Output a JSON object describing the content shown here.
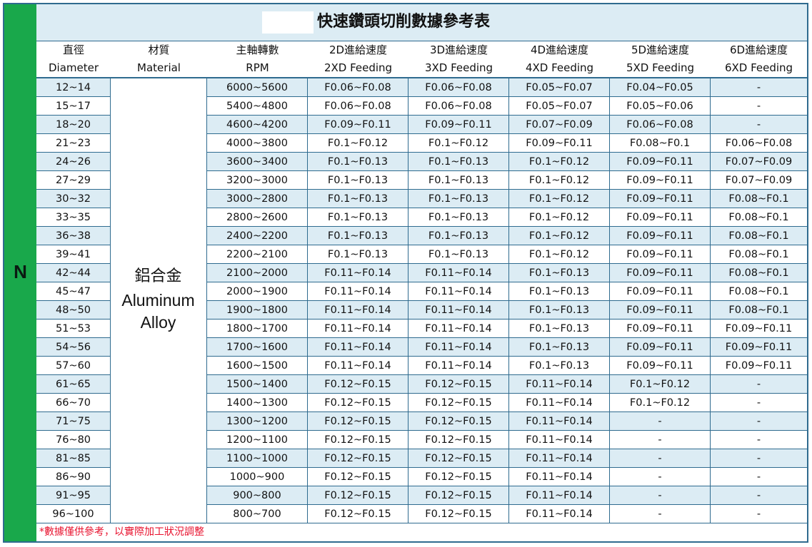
{
  "side_label": "N",
  "title": "快速鑽頭切削數據參考表",
  "columns": [
    {
      "zh": "直徑",
      "en": "Diameter"
    },
    {
      "zh": "材質",
      "en": "Material"
    },
    {
      "zh": "主軸轉數",
      "en": "RPM"
    },
    {
      "zh": "2D進給速度",
      "en": "2XD Feeding"
    },
    {
      "zh": "3D進給速度",
      "en": "3XD Feeding"
    },
    {
      "zh": "4D進給速度",
      "en": "4XD Feeding"
    },
    {
      "zh": "5D進給速度",
      "en": "5XD Feeding"
    },
    {
      "zh": "6D進給速度",
      "en": "6XD Feeding"
    }
  ],
  "material": {
    "zh": "鋁合金",
    "en_line1": "Aluminum",
    "en_line2": "Alloy"
  },
  "rows": [
    [
      "12~14",
      "6000~5600",
      "F0.06~F0.08",
      "F0.06~F0.08",
      "F0.05~F0.07",
      "F0.04~F0.05",
      "-"
    ],
    [
      "15~17",
      "5400~4800",
      "F0.06~F0.08",
      "F0.06~F0.08",
      "F0.05~F0.07",
      "F0.05~F0.06",
      "-"
    ],
    [
      "18~20",
      "4600~4200",
      "F0.09~F0.11",
      "F0.09~F0.11",
      "F0.07~F0.09",
      "F0.06~F0.08",
      "-"
    ],
    [
      "21~23",
      "4000~3800",
      "F0.1~F0.12",
      "F0.1~F0.12",
      "F0.09~F0.11",
      "F0.08~F0.1",
      "F0.06~F0.08"
    ],
    [
      "24~26",
      "3600~3400",
      "F0.1~F0.13",
      "F0.1~F0.13",
      "F0.1~F0.12",
      "F0.09~F0.11",
      "F0.07~F0.09"
    ],
    [
      "27~29",
      "3200~3000",
      "F0.1~F0.13",
      "F0.1~F0.13",
      "F0.1~F0.12",
      "F0.09~F0.11",
      "F0.07~F0.09"
    ],
    [
      "30~32",
      "3000~2800",
      "F0.1~F0.13",
      "F0.1~F0.13",
      "F0.1~F0.12",
      "F0.09~F0.11",
      "F0.08~F0.1"
    ],
    [
      "33~35",
      "2800~2600",
      "F0.1~F0.13",
      "F0.1~F0.13",
      "F0.1~F0.12",
      "F0.09~F0.11",
      "F0.08~F0.1"
    ],
    [
      "36~38",
      "2400~2200",
      "F0.1~F0.13",
      "F0.1~F0.13",
      "F0.1~F0.12",
      "F0.09~F0.11",
      "F0.08~F0.1"
    ],
    [
      "39~41",
      "2200~2100",
      "F0.1~F0.13",
      "F0.1~F0.13",
      "F0.1~F0.12",
      "F0.09~F0.11",
      "F0.08~F0.1"
    ],
    [
      "42~44",
      "2100~2000",
      "F0.11~F0.14",
      "F0.11~F0.14",
      "F0.1~F0.13",
      "F0.09~F0.11",
      "F0.08~F0.1"
    ],
    [
      "45~47",
      "2000~1900",
      "F0.11~F0.14",
      "F0.11~F0.14",
      "F0.1~F0.13",
      "F0.09~F0.11",
      "F0.08~F0.1"
    ],
    [
      "48~50",
      "1900~1800",
      "F0.11~F0.14",
      "F0.11~F0.14",
      "F0.1~F0.13",
      "F0.09~F0.11",
      "F0.08~F0.1"
    ],
    [
      "51~53",
      "1800~1700",
      "F0.11~F0.14",
      "F0.11~F0.14",
      "F0.1~F0.13",
      "F0.09~F0.11",
      "F0.09~F0.11"
    ],
    [
      "54~56",
      "1700~1600",
      "F0.11~F0.14",
      "F0.11~F0.14",
      "F0.1~F0.13",
      "F0.09~F0.11",
      "F0.09~F0.11"
    ],
    [
      "57~60",
      "1600~1500",
      "F0.11~F0.14",
      "F0.11~F0.14",
      "F0.1~F0.13",
      "F0.09~F0.11",
      "F0.09~F0.11"
    ],
    [
      "61~65",
      "1500~1400",
      "F0.12~F0.15",
      "F0.12~F0.15",
      "F0.11~F0.14",
      "F0.1~F0.12",
      "-"
    ],
    [
      "66~70",
      "1400~1300",
      "F0.12~F0.15",
      "F0.12~F0.15",
      "F0.11~F0.14",
      "F0.1~F0.12",
      "-"
    ],
    [
      "71~75",
      "1300~1200",
      "F0.12~F0.15",
      "F0.12~F0.15",
      "F0.11~F0.14",
      "-",
      "-"
    ],
    [
      "76~80",
      "1200~1100",
      "F0.12~F0.15",
      "F0.12~F0.15",
      "F0.11~F0.14",
      "-",
      "-"
    ],
    [
      "81~85",
      "1100~1000",
      "F0.12~F0.15",
      "F0.12~F0.15",
      "F0.11~F0.14",
      "-",
      "-"
    ],
    [
      "86~90",
      "1000~900",
      "F0.12~F0.15",
      "F0.12~F0.15",
      "F0.11~F0.14",
      "-",
      "-"
    ],
    [
      "91~95",
      "900~800",
      "F0.12~F0.15",
      "F0.12~F0.15",
      "F0.11~F0.14",
      "-",
      "-"
    ],
    [
      "96~100",
      "800~700",
      "F0.12~F0.15",
      "F0.12~F0.15",
      "F0.11~F0.14",
      "-",
      "-"
    ]
  ],
  "note": "*數據僅供參考，以實際加工狀況調整",
  "colors": {
    "side": "#19a84b",
    "stripe": "#dcecf4",
    "rule": "#2f6b8f",
    "note": "#e8112d"
  }
}
